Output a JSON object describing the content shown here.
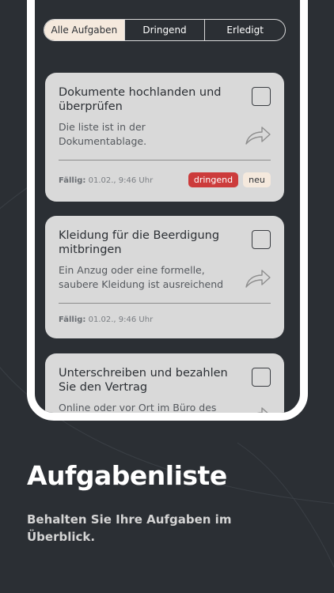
{
  "tabs": [
    {
      "label": "Alle Aufgaben",
      "active": true
    },
    {
      "label": "Dringend",
      "active": false
    },
    {
      "label": "Erledigt",
      "active": false
    }
  ],
  "tasks": [
    {
      "title": "Dokumente hochlanden und überprüfen",
      "description": "Die liste ist in der Dokumentablage.",
      "due_label": "Fällig:",
      "due_value": "01.02., 9:46 Uhr",
      "badges": [
        "dringend",
        "neu"
      ]
    },
    {
      "title": "Kleidung für die Beerdigung mitbringen",
      "description": "Ein Anzug oder eine formelle, saubere Kleidung ist ausreichend",
      "due_label": "Fällig:",
      "due_value": "01.02., 9:46 Uhr",
      "badges": []
    },
    {
      "title": "Unterschreiben und bezahlen Sie den Vertrag",
      "description": "Online oder vor Ort im Büro des Bestattungsunternehmens",
      "badges": []
    }
  ],
  "promo": {
    "headline": "Aufgabenliste",
    "subline": "Behalten Sie Ihre Aufgaben im Überblick."
  },
  "icons": {
    "checkbox": "checkbox-icon",
    "share": "share-arrow-icon"
  },
  "colors": {
    "background": "#2b2f34",
    "card": "#d9d9d9",
    "active_tab": "#f5e9dd",
    "urgent_badge": "#cc3b3b",
    "new_badge": "#f5e9dd"
  }
}
